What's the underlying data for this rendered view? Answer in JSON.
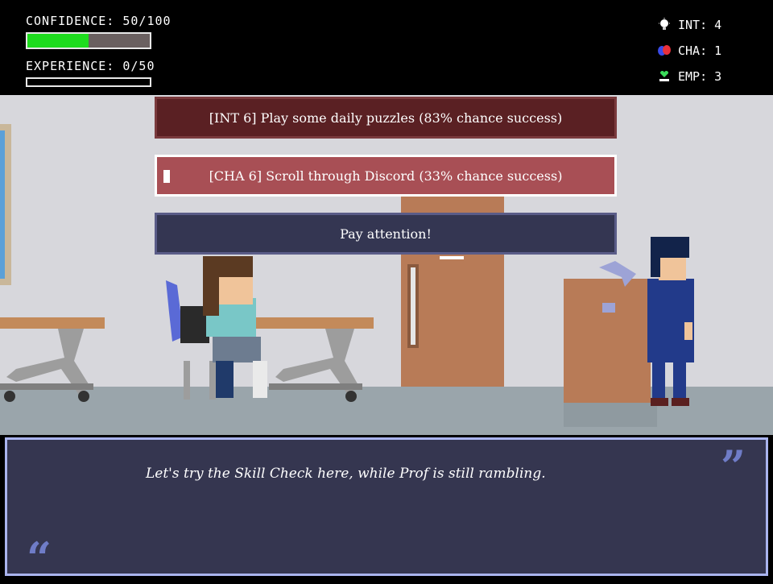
{
  "hud": {
    "confidence_label": "CONFIDENCE: 50/100",
    "confidence_fraction": 0.5,
    "experience_label": "EXPERIENCE: 0/50",
    "experience_fraction": 0.0,
    "stats": [
      {
        "label": "INT: 4",
        "icon": "lightbulb-icon"
      },
      {
        "label": "CHA: 1",
        "icon": "masks-icon"
      },
      {
        "label": "EMP: 3",
        "icon": "heart-hand-icon"
      }
    ]
  },
  "choices": [
    {
      "text": "[INT 6] Play some daily puzzles (83% chance success)",
      "color": "#5a2023"
    },
    {
      "text": "[CHA 6] Scroll through Discord (33% chance success)",
      "color": "#a84f55"
    },
    {
      "text": "Pay attention!",
      "color": "#343652"
    }
  ],
  "dialogue": {
    "text": "Let's try the Skill Check here, while Prof is still rambling."
  },
  "colors": {
    "confidence_fill": "#1edc1e",
    "dialogue_bg": "#353650",
    "dialogue_border": "#aab4ee",
    "wall": "#d7d7dc",
    "floor": "#9aa5ab"
  }
}
